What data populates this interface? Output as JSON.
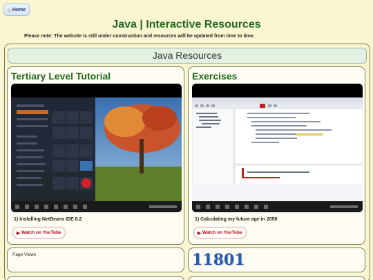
{
  "nav": {
    "home_label": "Home",
    "home_icon": "home-icon"
  },
  "header": {
    "title": "Java | Interactive Resources",
    "note": "Please note: The website is still under construction and resources will be updated from time to time."
  },
  "section": {
    "title": "Java Resources"
  },
  "cards": [
    {
      "heading": "Tertiary Level Tutorial",
      "video_title": "1) Installing NetBeans IDE 8.2",
      "button_label": "Watch on YouTube"
    },
    {
      "heading": "Exercises",
      "video_title": "1) Calculating my future age in 2050",
      "button_label": "Watch on YouTube"
    }
  ],
  "page_views": {
    "label": "Page Views",
    "count": "11801"
  },
  "colors": {
    "accent": "#1f6b1f",
    "background": "#fbf6d2",
    "youtube": "#b00000"
  }
}
